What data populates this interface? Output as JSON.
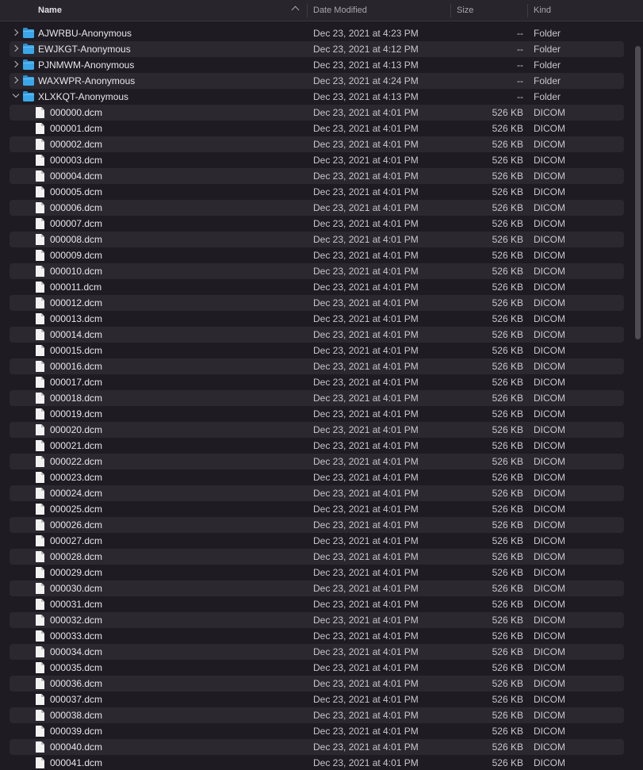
{
  "columns": {
    "name": "Name",
    "date": "Date Modified",
    "size": "Size",
    "kind": "Kind"
  },
  "folders": [
    {
      "name": "AJWRBU-Anonymous",
      "date": "Dec 23, 2021 at 4:23 PM",
      "size": "--",
      "kind": "Folder",
      "expanded": false
    },
    {
      "name": "EWJKGT-Anonymous",
      "date": "Dec 23, 2021 at 4:12 PM",
      "size": "--",
      "kind": "Folder",
      "expanded": false
    },
    {
      "name": "PJNMWM-Anonymous",
      "date": "Dec 23, 2021 at 4:13 PM",
      "size": "--",
      "kind": "Folder",
      "expanded": false
    },
    {
      "name": "WAXWPR-Anonymous",
      "date": "Dec 23, 2021 at 4:24 PM",
      "size": "--",
      "kind": "Folder",
      "expanded": false
    },
    {
      "name": "XLXKQT-Anonymous",
      "date": "Dec 23, 2021 at 4:13 PM",
      "size": "--",
      "kind": "Folder",
      "expanded": true
    }
  ],
  "files": [
    {
      "name": "000000.dcm",
      "date": "Dec 23, 2021 at 4:01 PM",
      "size": "526 KB",
      "kind": "DICOM"
    },
    {
      "name": "000001.dcm",
      "date": "Dec 23, 2021 at 4:01 PM",
      "size": "526 KB",
      "kind": "DICOM"
    },
    {
      "name": "000002.dcm",
      "date": "Dec 23, 2021 at 4:01 PM",
      "size": "526 KB",
      "kind": "DICOM"
    },
    {
      "name": "000003.dcm",
      "date": "Dec 23, 2021 at 4:01 PM",
      "size": "526 KB",
      "kind": "DICOM"
    },
    {
      "name": "000004.dcm",
      "date": "Dec 23, 2021 at 4:01 PM",
      "size": "526 KB",
      "kind": "DICOM"
    },
    {
      "name": "000005.dcm",
      "date": "Dec 23, 2021 at 4:01 PM",
      "size": "526 KB",
      "kind": "DICOM"
    },
    {
      "name": "000006.dcm",
      "date": "Dec 23, 2021 at 4:01 PM",
      "size": "526 KB",
      "kind": "DICOM"
    },
    {
      "name": "000007.dcm",
      "date": "Dec 23, 2021 at 4:01 PM",
      "size": "526 KB",
      "kind": "DICOM"
    },
    {
      "name": "000008.dcm",
      "date": "Dec 23, 2021 at 4:01 PM",
      "size": "526 KB",
      "kind": "DICOM"
    },
    {
      "name": "000009.dcm",
      "date": "Dec 23, 2021 at 4:01 PM",
      "size": "526 KB",
      "kind": "DICOM"
    },
    {
      "name": "000010.dcm",
      "date": "Dec 23, 2021 at 4:01 PM",
      "size": "526 KB",
      "kind": "DICOM"
    },
    {
      "name": "000011.dcm",
      "date": "Dec 23, 2021 at 4:01 PM",
      "size": "526 KB",
      "kind": "DICOM"
    },
    {
      "name": "000012.dcm",
      "date": "Dec 23, 2021 at 4:01 PM",
      "size": "526 KB",
      "kind": "DICOM"
    },
    {
      "name": "000013.dcm",
      "date": "Dec 23, 2021 at 4:01 PM",
      "size": "526 KB",
      "kind": "DICOM"
    },
    {
      "name": "000014.dcm",
      "date": "Dec 23, 2021 at 4:01 PM",
      "size": "526 KB",
      "kind": "DICOM"
    },
    {
      "name": "000015.dcm",
      "date": "Dec 23, 2021 at 4:01 PM",
      "size": "526 KB",
      "kind": "DICOM"
    },
    {
      "name": "000016.dcm",
      "date": "Dec 23, 2021 at 4:01 PM",
      "size": "526 KB",
      "kind": "DICOM"
    },
    {
      "name": "000017.dcm",
      "date": "Dec 23, 2021 at 4:01 PM",
      "size": "526 KB",
      "kind": "DICOM"
    },
    {
      "name": "000018.dcm",
      "date": "Dec 23, 2021 at 4:01 PM",
      "size": "526 KB",
      "kind": "DICOM"
    },
    {
      "name": "000019.dcm",
      "date": "Dec 23, 2021 at 4:01 PM",
      "size": "526 KB",
      "kind": "DICOM"
    },
    {
      "name": "000020.dcm",
      "date": "Dec 23, 2021 at 4:01 PM",
      "size": "526 KB",
      "kind": "DICOM"
    },
    {
      "name": "000021.dcm",
      "date": "Dec 23, 2021 at 4:01 PM",
      "size": "526 KB",
      "kind": "DICOM"
    },
    {
      "name": "000022.dcm",
      "date": "Dec 23, 2021 at 4:01 PM",
      "size": "526 KB",
      "kind": "DICOM"
    },
    {
      "name": "000023.dcm",
      "date": "Dec 23, 2021 at 4:01 PM",
      "size": "526 KB",
      "kind": "DICOM"
    },
    {
      "name": "000024.dcm",
      "date": "Dec 23, 2021 at 4:01 PM",
      "size": "526 KB",
      "kind": "DICOM"
    },
    {
      "name": "000025.dcm",
      "date": "Dec 23, 2021 at 4:01 PM",
      "size": "526 KB",
      "kind": "DICOM"
    },
    {
      "name": "000026.dcm",
      "date": "Dec 23, 2021 at 4:01 PM",
      "size": "526 KB",
      "kind": "DICOM"
    },
    {
      "name": "000027.dcm",
      "date": "Dec 23, 2021 at 4:01 PM",
      "size": "526 KB",
      "kind": "DICOM"
    },
    {
      "name": "000028.dcm",
      "date": "Dec 23, 2021 at 4:01 PM",
      "size": "526 KB",
      "kind": "DICOM"
    },
    {
      "name": "000029.dcm",
      "date": "Dec 23, 2021 at 4:01 PM",
      "size": "526 KB",
      "kind": "DICOM"
    },
    {
      "name": "000030.dcm",
      "date": "Dec 23, 2021 at 4:01 PM",
      "size": "526 KB",
      "kind": "DICOM"
    },
    {
      "name": "000031.dcm",
      "date": "Dec 23, 2021 at 4:01 PM",
      "size": "526 KB",
      "kind": "DICOM"
    },
    {
      "name": "000032.dcm",
      "date": "Dec 23, 2021 at 4:01 PM",
      "size": "526 KB",
      "kind": "DICOM"
    },
    {
      "name": "000033.dcm",
      "date": "Dec 23, 2021 at 4:01 PM",
      "size": "526 KB",
      "kind": "DICOM"
    },
    {
      "name": "000034.dcm",
      "date": "Dec 23, 2021 at 4:01 PM",
      "size": "526 KB",
      "kind": "DICOM"
    },
    {
      "name": "000035.dcm",
      "date": "Dec 23, 2021 at 4:01 PM",
      "size": "526 KB",
      "kind": "DICOM"
    },
    {
      "name": "000036.dcm",
      "date": "Dec 23, 2021 at 4:01 PM",
      "size": "526 KB",
      "kind": "DICOM"
    },
    {
      "name": "000037.dcm",
      "date": "Dec 23, 2021 at 4:01 PM",
      "size": "526 KB",
      "kind": "DICOM"
    },
    {
      "name": "000038.dcm",
      "date": "Dec 23, 2021 at 4:01 PM",
      "size": "526 KB",
      "kind": "DICOM"
    },
    {
      "name": "000039.dcm",
      "date": "Dec 23, 2021 at 4:01 PM",
      "size": "526 KB",
      "kind": "DICOM"
    },
    {
      "name": "000040.dcm",
      "date": "Dec 23, 2021 at 4:01 PM",
      "size": "526 KB",
      "kind": "DICOM"
    },
    {
      "name": "000041.dcm",
      "date": "Dec 23, 2021 at 4:01 PM",
      "size": "526 KB",
      "kind": "DICOM"
    }
  ]
}
